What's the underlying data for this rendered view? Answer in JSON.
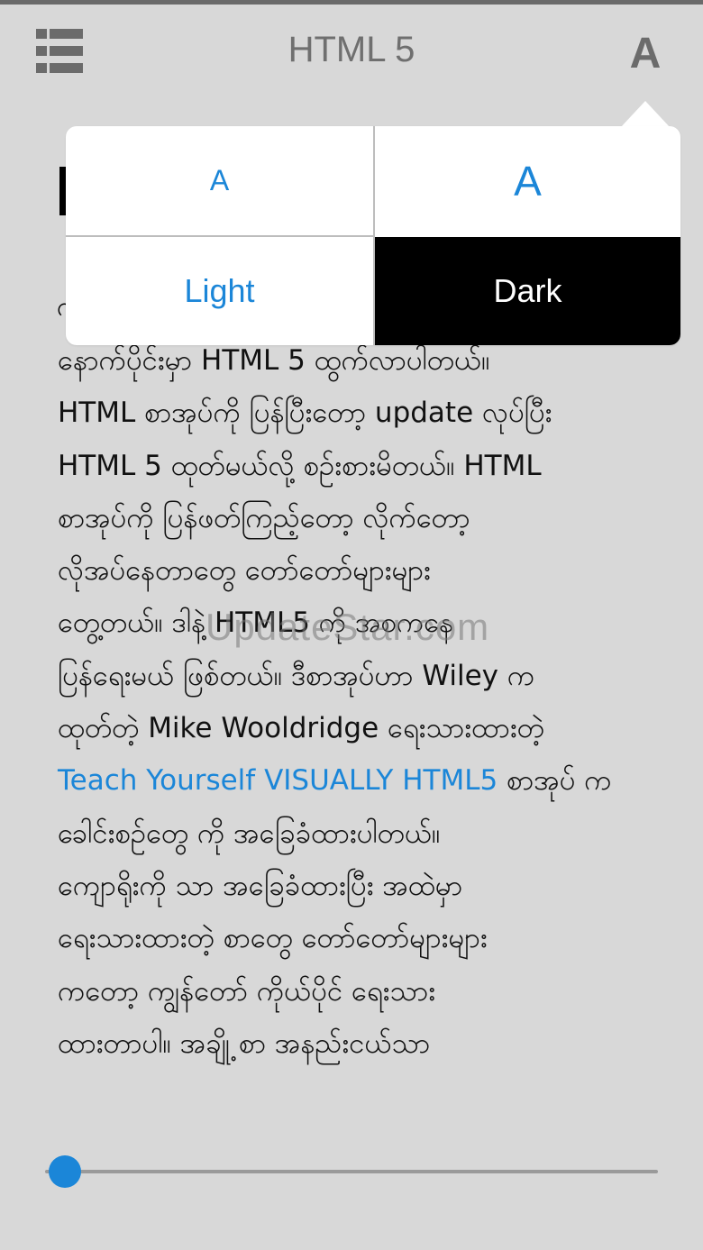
{
  "header": {
    "title": "HTML 5",
    "menu_icon": "list-menu-icon",
    "font_icon_glyph": "A"
  },
  "popover": {
    "font_small": "A",
    "font_large": "A",
    "theme_light": "Light",
    "theme_dark": "Dark"
  },
  "content": {
    "lines": [
      "နောက်ပိုင်းမှာ HTML 5 ထွက်လာပါတယ်။",
      "HTML စာအုပ်ကို ပြန်ပြီးတော့ update လုပ်ပြီး",
      "HTML 5 ထုတ်မယ်လို့ စဉ်းစားမိတယ်။ HTML",
      "စာအုပ်ကို ပြန်ဖတ်ကြည့်တော့ လိုက်တော့",
      "လိုအပ်နေတာတွေ တော်တော်များများ",
      "တွေ့တယ်။ ဒါနဲ့ HTML5 ကို အစကနေ",
      "ပြန်ရေးမယ် ဖြစ်တယ်။ ဒီစာအုပ်ဟာ Wiley က",
      "ထုတ်တဲ့ Mike Wooldridge ရေးသားထားတဲ့"
    ],
    "link_text": "Teach Yourself VISUALLY HTML5",
    "after_link": " စာအုပ် က",
    "lines2": [
      "ခေါင်းစဉ်တွေ ကို အခြေခံထားပါတယ်။",
      "ကျောရိုးကို သာ အခြေခံထားပြီး အထဲမှာ",
      "ရေးသားထားတဲ့ စာတွေ တော်တော်များများ",
      "ကတော့ ကျွန်တော် ကိုယ်ပိုင် ရေးသား",
      "ထားတာပါ။ အချို့ စာ အနည်းငယ်သာ"
    ],
    "partial_char": "ဂ"
  },
  "watermark": "UpdateStar.com",
  "progress": {
    "value": 0.0
  },
  "colors": {
    "accent": "#1b86d8",
    "background": "#d8d8d8",
    "dark_theme": "#000000"
  }
}
